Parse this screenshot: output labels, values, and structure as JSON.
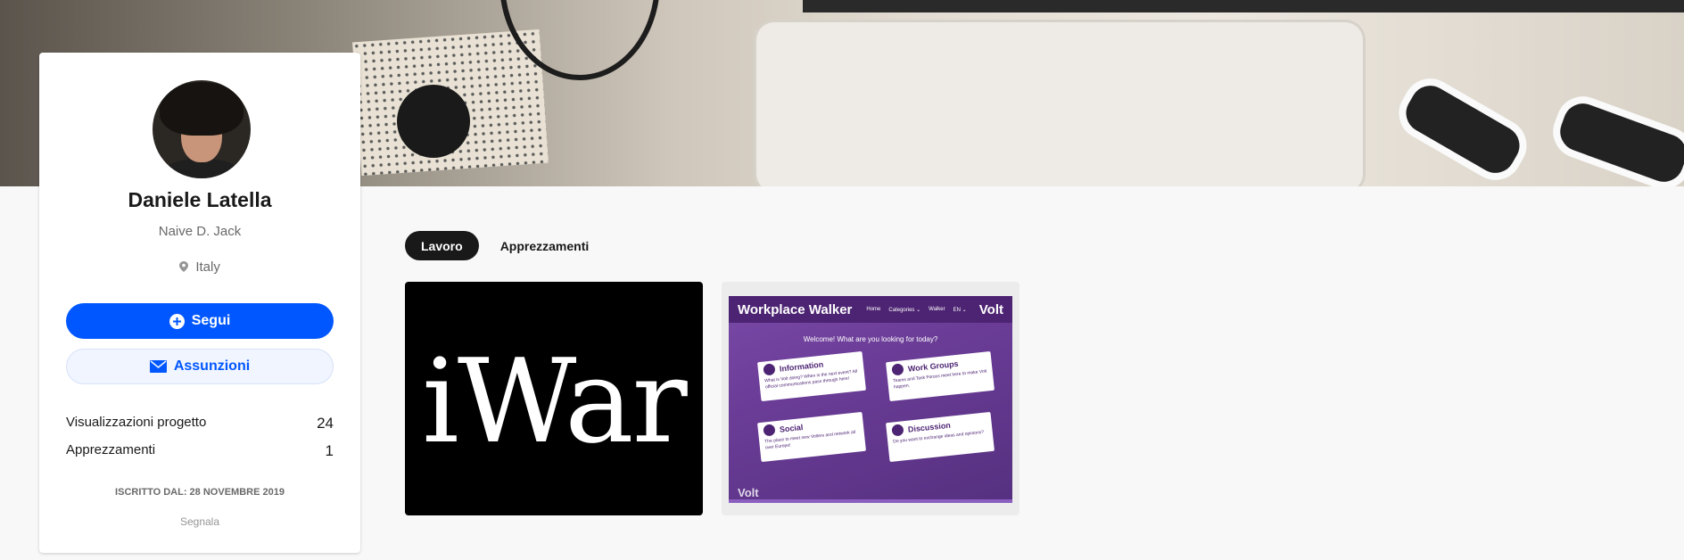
{
  "profile": {
    "name": "Daniele Latella",
    "occupation": "Naive D. Jack",
    "location": "Italy",
    "follow_label": "Segui",
    "hire_label": "Assunzioni",
    "stats": [
      {
        "label": "Visualizzazioni progetto",
        "value": "24"
      },
      {
        "label": "Apprezzamenti",
        "value": "1"
      }
    ],
    "member_since": "ISCRITTO DAL: 28 NOVEMBRE 2019",
    "report_label": "Segnala"
  },
  "tabs": [
    {
      "label": "Lavoro",
      "active": true
    },
    {
      "label": "Apprezzamenti",
      "active": false
    }
  ],
  "projects": [
    {
      "cover_text": "iWar"
    },
    {
      "site_title": "Workplace Walker",
      "site_nav": [
        "Home",
        "Categories ⌄",
        "Walker",
        "EN ⌄"
      ],
      "site_brand": "Volt",
      "site_welcome": "Welcome! What are you looking for today?",
      "tiles": [
        {
          "title": "Information",
          "desc": "What is Volt doing? When is the next event? All official communications pass through here!"
        },
        {
          "title": "Work Groups",
          "desc": "Teams and Task Forces meet here to make Volt happen."
        },
        {
          "title": "Social",
          "desc": "The place to meet new Volters and network all over Europe!"
        },
        {
          "title": "Discussion",
          "desc": "Do you want to exchange ideas and opinions?"
        }
      ]
    }
  ],
  "colors": {
    "accent": "#0057ff",
    "hire_bg": "#f1f5ff",
    "tab_active": "#191919",
    "volt_purple": "#502379"
  },
  "icons": {
    "follow": "plus-circle-icon",
    "hire": "mail-icon",
    "location": "location-pin-icon"
  }
}
